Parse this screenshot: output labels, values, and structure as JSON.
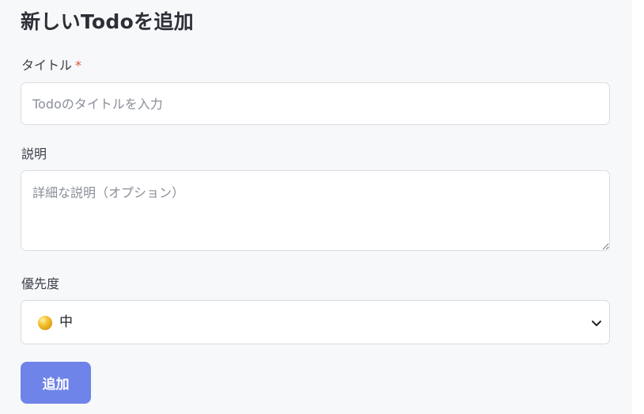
{
  "form": {
    "heading": "新しいTodoを追加",
    "title_field": {
      "label": "タイトル",
      "required_mark": "*",
      "placeholder": "Todoのタイトルを入力",
      "value": ""
    },
    "description_field": {
      "label": "説明",
      "placeholder": "詳細な説明（オプション）",
      "value": ""
    },
    "priority_field": {
      "label": "優先度",
      "selected_value": "中",
      "selected_icon": "yellow-circle-icon",
      "indicator_color": "#f2b924"
    },
    "submit_label": "追加"
  },
  "colors": {
    "panel_background": "#f7f8fa",
    "required_mark": "#e0533d",
    "button_background": "#6f84e8",
    "button_text": "#ffffff"
  }
}
